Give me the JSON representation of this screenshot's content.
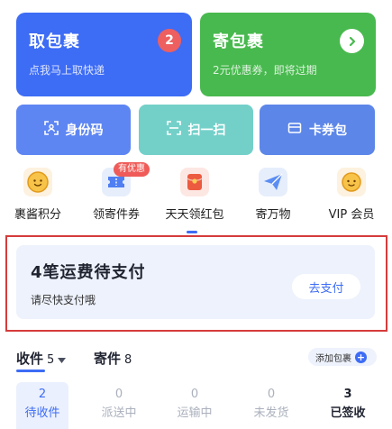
{
  "cards": {
    "pickup": {
      "title": "取包裹",
      "subtitle": "点我马上取快递",
      "badge": "2"
    },
    "send": {
      "title": "寄包裹",
      "subtitle": "2元优惠券，即将过期"
    }
  },
  "buttons": [
    {
      "label": "身份码",
      "icon": "id-scan-icon"
    },
    {
      "label": "扫一扫",
      "icon": "scan-icon"
    },
    {
      "label": "卡券包",
      "icon": "wallet-icon"
    }
  ],
  "services": [
    {
      "label": "裹酱积分",
      "icon": "mascot-points-icon"
    },
    {
      "label": "领寄件券",
      "icon": "coupon-icon",
      "tag": "有优惠"
    },
    {
      "label": "天天领红包",
      "icon": "red-packet-icon"
    },
    {
      "label": "寄万物",
      "icon": "paper-plane-icon"
    },
    {
      "label": "VIP 会员",
      "icon": "vip-mascot-icon"
    }
  ],
  "payment": {
    "title": "4笔运费待支付",
    "subtitle": "请尽快支付哦",
    "button": "去支付"
  },
  "tabs": [
    {
      "label": "收件",
      "count": "5"
    },
    {
      "label": "寄件",
      "count": "8"
    }
  ],
  "add_package": "添加包裹",
  "statuses": [
    {
      "count": "2",
      "label": "待收件"
    },
    {
      "count": "0",
      "label": "派送中"
    },
    {
      "count": "0",
      "label": "运输中"
    },
    {
      "count": "0",
      "label": "未发货"
    },
    {
      "count": "3",
      "label": "已签收"
    }
  ],
  "colors": {
    "accent": "#3d6cf5",
    "send_green": "#48b94e",
    "alert_red": "#ee5f5f"
  }
}
